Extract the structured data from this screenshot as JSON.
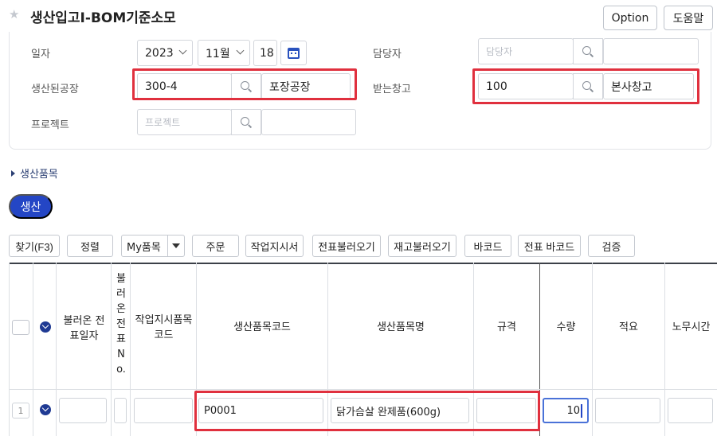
{
  "header": {
    "title": "생산입고I-BOM기준소모",
    "option_label": "Option",
    "help_label": "도움말"
  },
  "form": {
    "date_label": "일자",
    "year": "2023",
    "month": "11월",
    "day": "18",
    "manager_label": "담당자",
    "manager_placeholder": "담당자",
    "factory_label": "생산된공장",
    "factory_code": "300-4",
    "factory_name": "포장공장",
    "warehouse_label": "받는창고",
    "warehouse_code": "100",
    "warehouse_name": "본사창고",
    "project_label": "프로젝트",
    "project_placeholder": "프로젝트"
  },
  "section": {
    "title": "생산품목"
  },
  "actions": {
    "produce_label": "생산"
  },
  "toolbar": {
    "find": "찾기(F3)",
    "sort": "정렬",
    "my_items": "My품목",
    "order": "주문",
    "work_order": "작업지시서",
    "load_slip": "전표불러오기",
    "load_stock": "재고불러오기",
    "barcode": "바코드",
    "slip_barcode": "전표 바코드",
    "verify": "검증"
  },
  "table": {
    "headers": {
      "loaded_date": "불러온 전\n표일자",
      "loaded_no": "불\n러\n온\n전\n표\nN\no.",
      "work_item_code": "작업지시품목\n코드",
      "item_code": "생산품목코드",
      "item_name": "생산품목명",
      "spec": "규격",
      "qty": "수량",
      "memo": "적요",
      "labor_time": "노무시간"
    },
    "rows": [
      {
        "num": "1",
        "item_code": "P0001",
        "item_name": "닭가슴살 완제품(600g)",
        "qty": "10"
      }
    ]
  },
  "colors": {
    "primary": "#2446c5",
    "highlight": "#e0303e",
    "section_text": "#2b3f73"
  }
}
